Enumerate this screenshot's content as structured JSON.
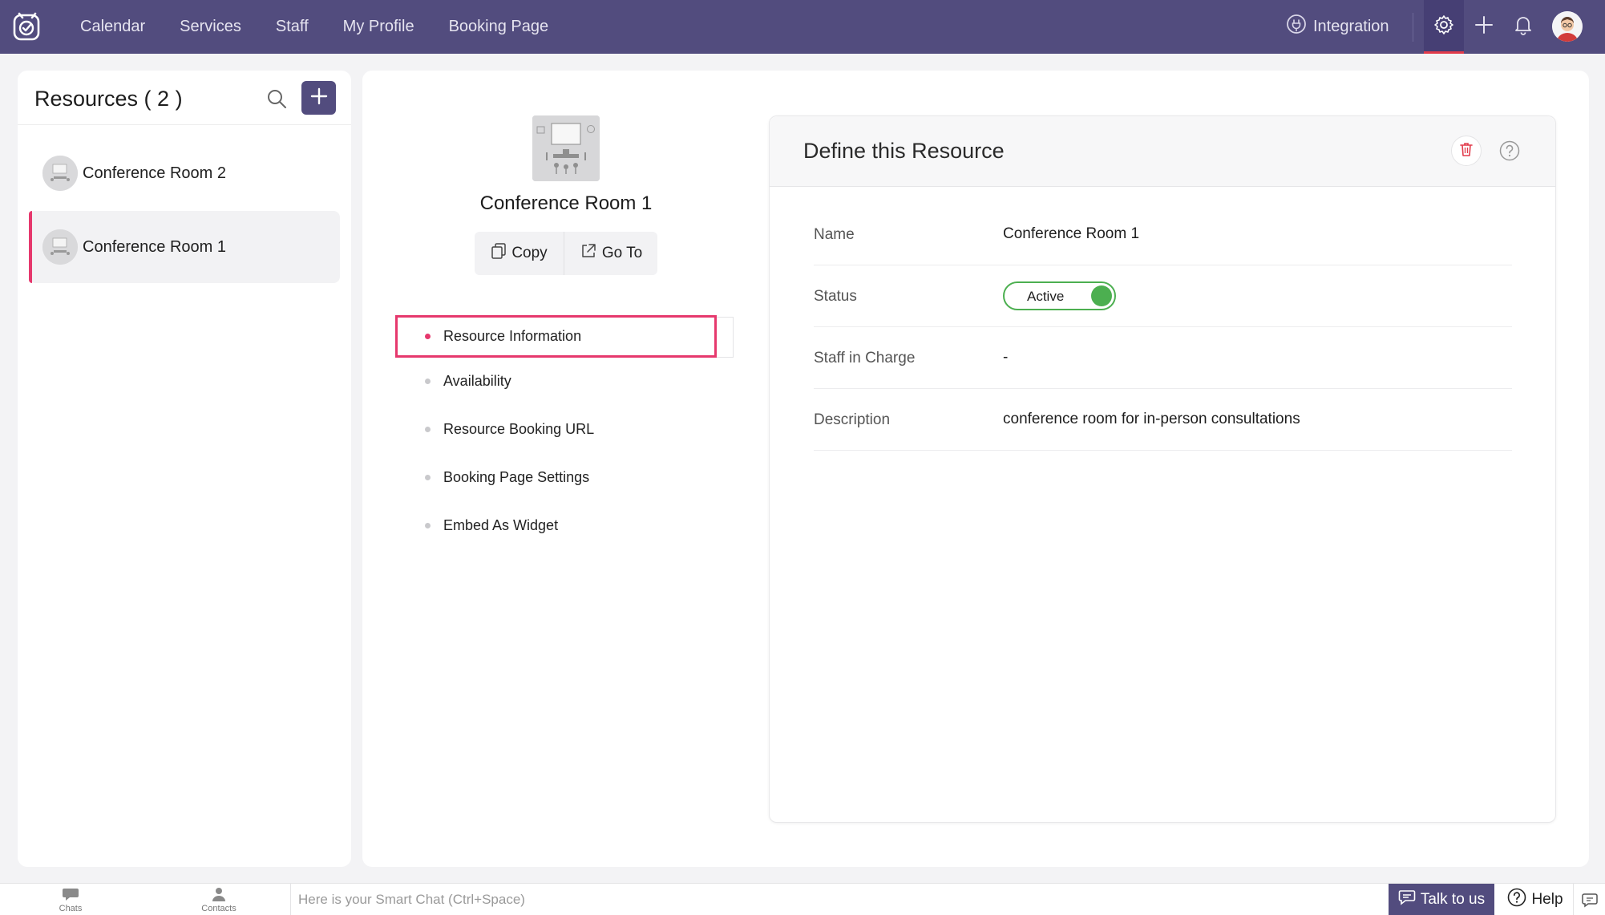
{
  "topbar": {
    "nav": [
      "Calendar",
      "Services",
      "Staff",
      "My Profile",
      "Booking Page"
    ],
    "integration_label": "Integration",
    "accent": "#524c7e",
    "active_indicator": "#e23b4b",
    "icons": [
      "app-logo-icon",
      "integration-icon",
      "gear-icon",
      "plus-icon",
      "bell-icon",
      "avatar"
    ]
  },
  "resources": {
    "title": "Resources ( 2 )",
    "items": [
      {
        "name": "Conference Room 2",
        "selected": false
      },
      {
        "name": "Conference Room 1",
        "selected": true
      }
    ]
  },
  "detail": {
    "title": "Conference Room 1",
    "copy_label": "Copy",
    "goto_label": "Go To",
    "menu": [
      {
        "label": "Resource Information",
        "active": true
      },
      {
        "label": "Availability",
        "active": false
      },
      {
        "label": "Resource Booking URL",
        "active": false
      },
      {
        "label": "Booking Page Settings",
        "active": false
      },
      {
        "label": "Embed As Widget",
        "active": false
      }
    ]
  },
  "define": {
    "title": "Define this Resource",
    "rows": {
      "name": {
        "label": "Name",
        "value": "Conference Room 1"
      },
      "status": {
        "label": "Status",
        "value": "Active",
        "on": true
      },
      "staff": {
        "label": "Staff in Charge",
        "value": "-"
      },
      "description": {
        "label": "Description",
        "value": "conference room for in-person consultations"
      }
    },
    "toggle_color": "#4caf50",
    "highlight_color": "#e6386d"
  },
  "bottombar": {
    "chats_label": "Chats",
    "contacts_label": "Contacts",
    "chat_placeholder": "Here is your Smart Chat (Ctrl+Space)",
    "talk_label": "Talk to us",
    "help_label": "Help"
  }
}
